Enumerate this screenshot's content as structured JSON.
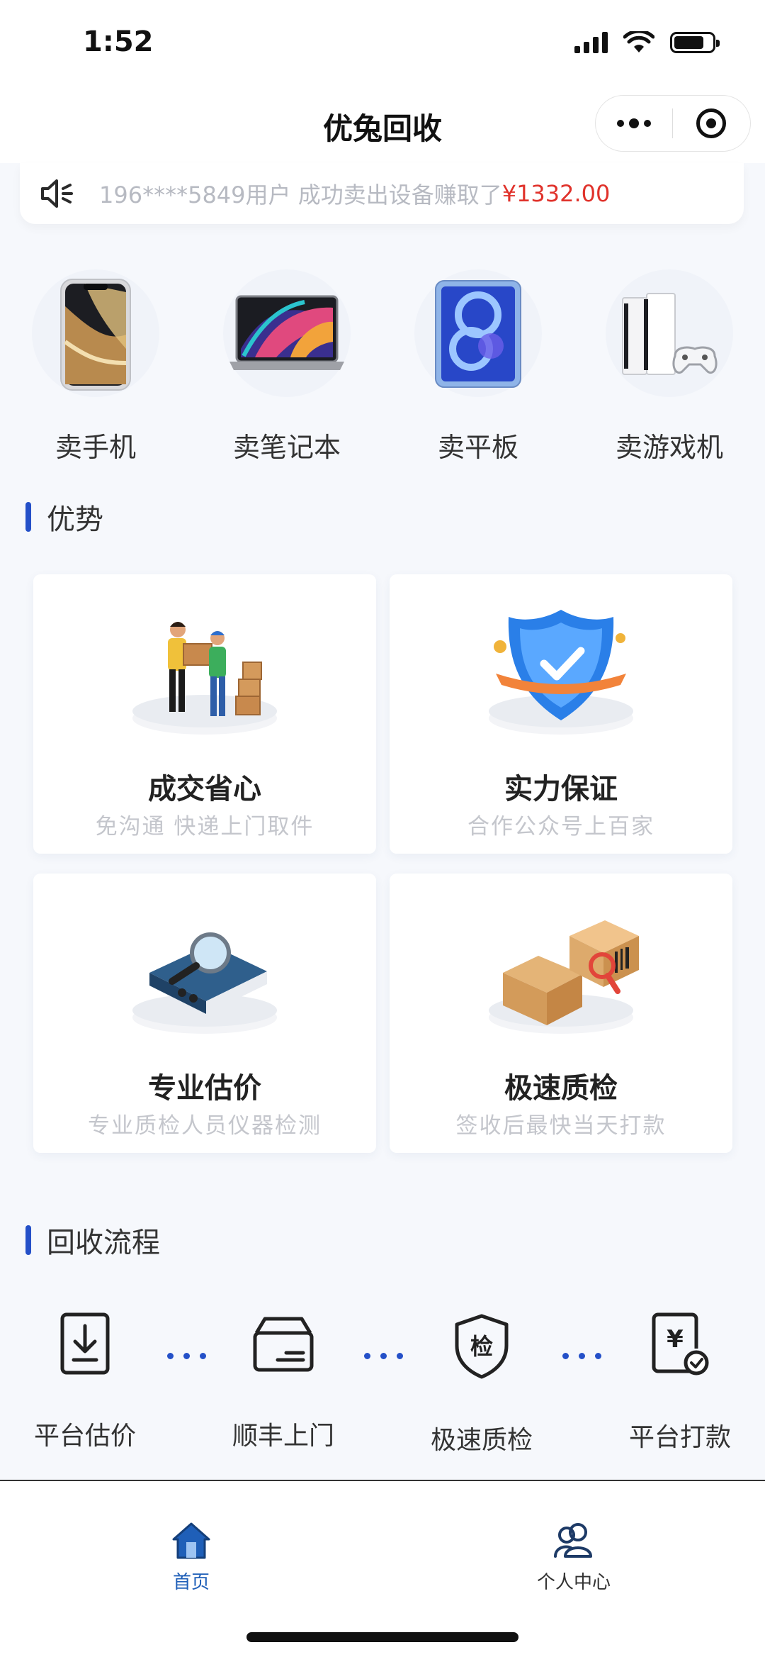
{
  "status_bar": {
    "time": "1:52"
  },
  "nav": {
    "title": "优兔回收"
  },
  "notice": {
    "text": "196****5849用户 成功卖出设备赚取了",
    "amount": "¥1332.00"
  },
  "categories": [
    {
      "label": "卖手机",
      "icon": "phone-icon"
    },
    {
      "label": "卖笔记本",
      "icon": "laptop-icon"
    },
    {
      "label": "卖平板",
      "icon": "tablet-icon"
    },
    {
      "label": "卖游戏机",
      "icon": "game-console-icon"
    }
  ],
  "advantages": {
    "title": "优势",
    "cards": [
      {
        "title": "成交省心",
        "subtitle": "免沟通 快递上门取件"
      },
      {
        "title": "实力保证",
        "subtitle": "合作公众号上百家"
      },
      {
        "title": "专业估价",
        "subtitle": "专业质检人员仪器检测"
      },
      {
        "title": "极速质检",
        "subtitle": "签收后最快当天打款"
      }
    ]
  },
  "process": {
    "title": "回收流程",
    "steps": [
      {
        "label": "平台估价",
        "icon": "download-doc-icon"
      },
      {
        "label": "顺丰上门",
        "icon": "box-icon"
      },
      {
        "label": "极速质检",
        "icon": "shield-check-icon",
        "glyph": "检"
      },
      {
        "label": "平台打款",
        "icon": "payment-icon",
        "glyph": "¥"
      }
    ]
  },
  "tab_bar": {
    "tabs": [
      {
        "label": "首页",
        "icon": "home-icon",
        "active": true
      },
      {
        "label": "个人中心",
        "icon": "users-icon",
        "active": false
      }
    ]
  },
  "colors": {
    "accent": "#2450c8",
    "amount": "#e0322b",
    "active_tab": "#1f5fb8"
  }
}
